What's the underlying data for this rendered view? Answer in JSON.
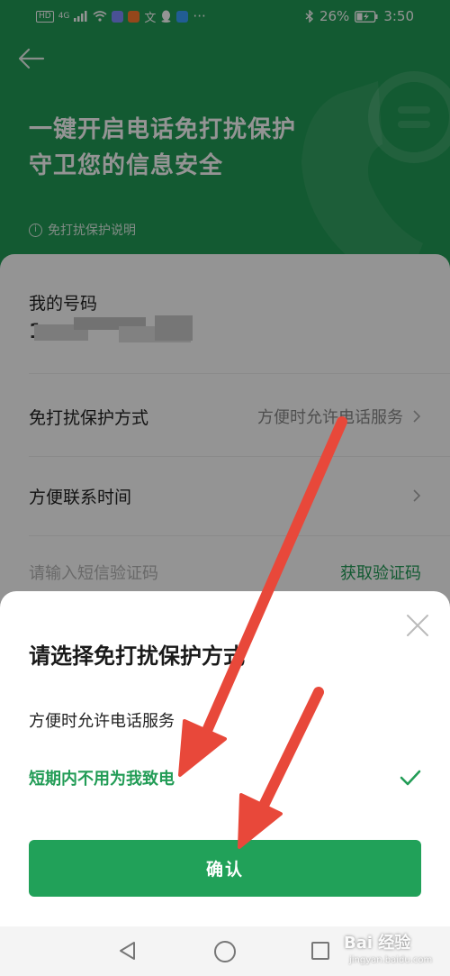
{
  "status_bar": {
    "hd": "HD",
    "network": "4G",
    "battery_percent": "26%",
    "time": "3:50",
    "ellipsis": "···"
  },
  "header": {
    "hero_line1": "一键开启电话免打扰保护",
    "hero_line2": "守卫您的信息安全",
    "info_link": "免打扰保护说明"
  },
  "form": {
    "phone_label": "我的号码",
    "phone_prefix": "1",
    "mode_label": "免打扰保护方式",
    "mode_value": "方便时允许电话服务",
    "time_label": "方便联系时间",
    "sms_placeholder": "请输入短信验证码",
    "sms_get_code": "获取验证码"
  },
  "sheet": {
    "title": "请选择免打扰保护方式",
    "options": [
      {
        "label": "方便时允许电话服务",
        "selected": false
      },
      {
        "label": "短期内不用为我致电",
        "selected": true
      }
    ],
    "confirm_label": "确认"
  },
  "watermark": {
    "brand": "Bai 经验",
    "url": "jingyan.baidu.com"
  },
  "colors": {
    "brand_green": "#229c56",
    "annotation_red": "#e8483a"
  }
}
